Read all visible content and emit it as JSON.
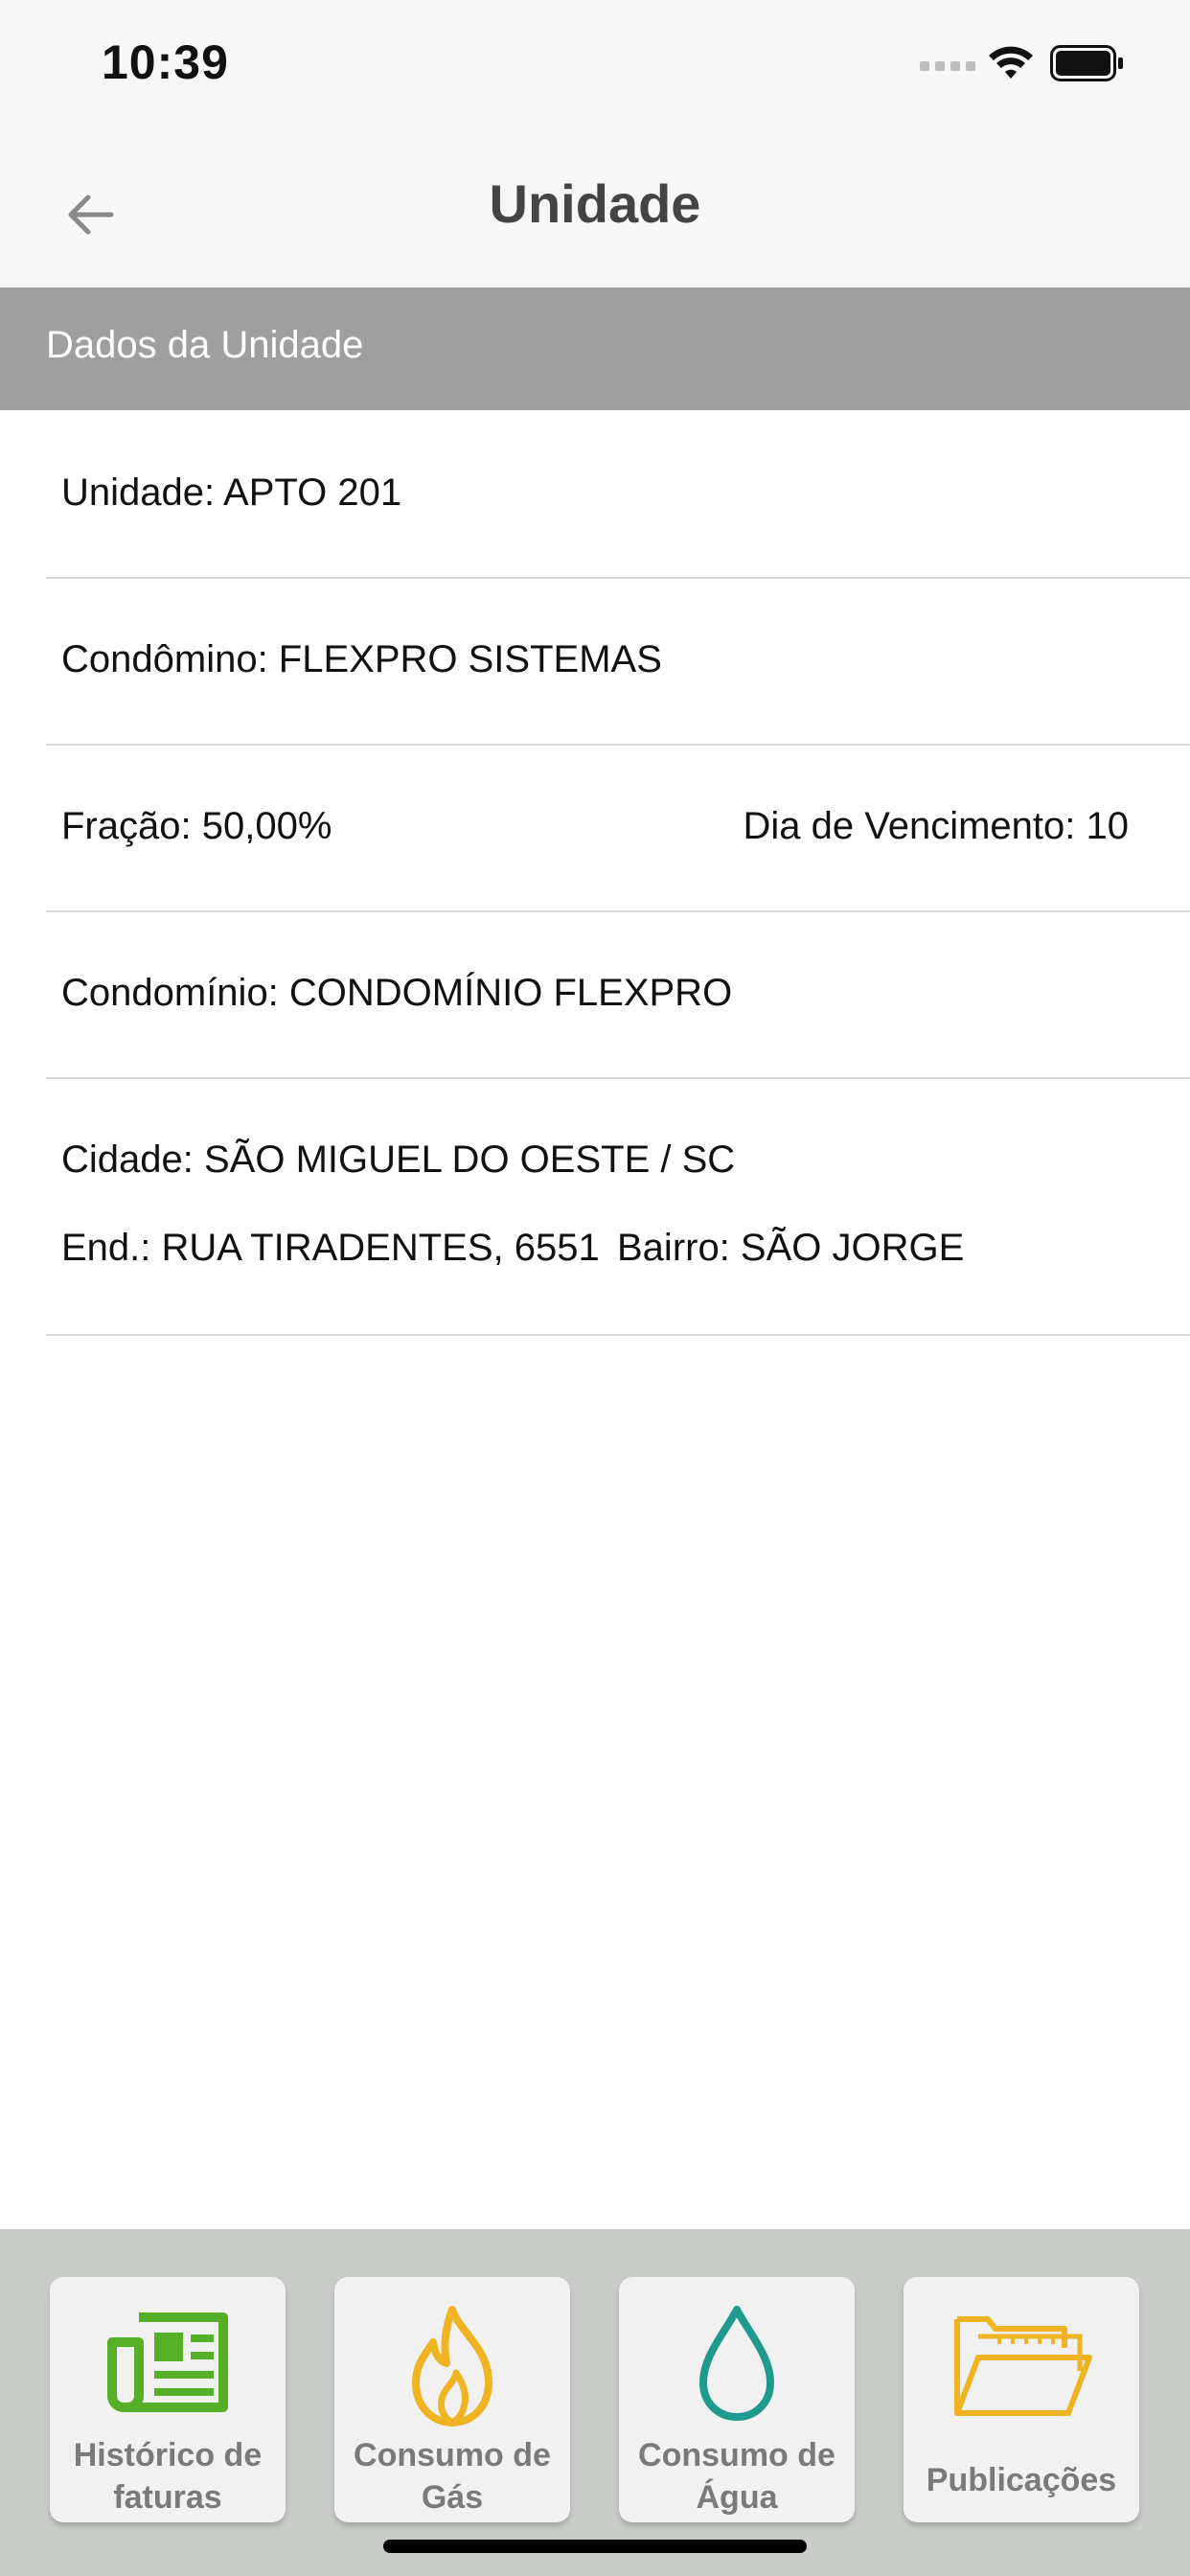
{
  "status_bar": {
    "time": "10:39"
  },
  "nav": {
    "title": "Unidade"
  },
  "section": {
    "title": "Dados da Unidade"
  },
  "unit": {
    "unidade": "Unidade: APTO 201",
    "condomino": "Condômino: FLEXPRO SISTEMAS",
    "fracao": "Fração: 50,00%",
    "vencimento": "Dia de Vencimento: 10",
    "condominio": "Condomínio: CONDOMÍNIO FLEXPRO",
    "cidade": "Cidade: SÃO MIGUEL DO OESTE / SC",
    "endereco": "End.: RUA TIRADENTES, 6551",
    "bairro": "Bairro: SÃO JORGE"
  },
  "tabs": [
    {
      "label_line1": "Histórico de",
      "label_line2": "faturas",
      "icon": "newspaper-icon",
      "color": "#55b027"
    },
    {
      "label_line1": "Consumo de",
      "label_line2": "Gás",
      "icon": "flame-icon",
      "color": "#f0b322"
    },
    {
      "label_line1": "Consumo de",
      "label_line2": "Água",
      "icon": "water-drop-icon",
      "color": "#1e9a8e"
    },
    {
      "label_line1": "Publicações",
      "icon": "folder-icon",
      "color": "#f0b322"
    }
  ]
}
